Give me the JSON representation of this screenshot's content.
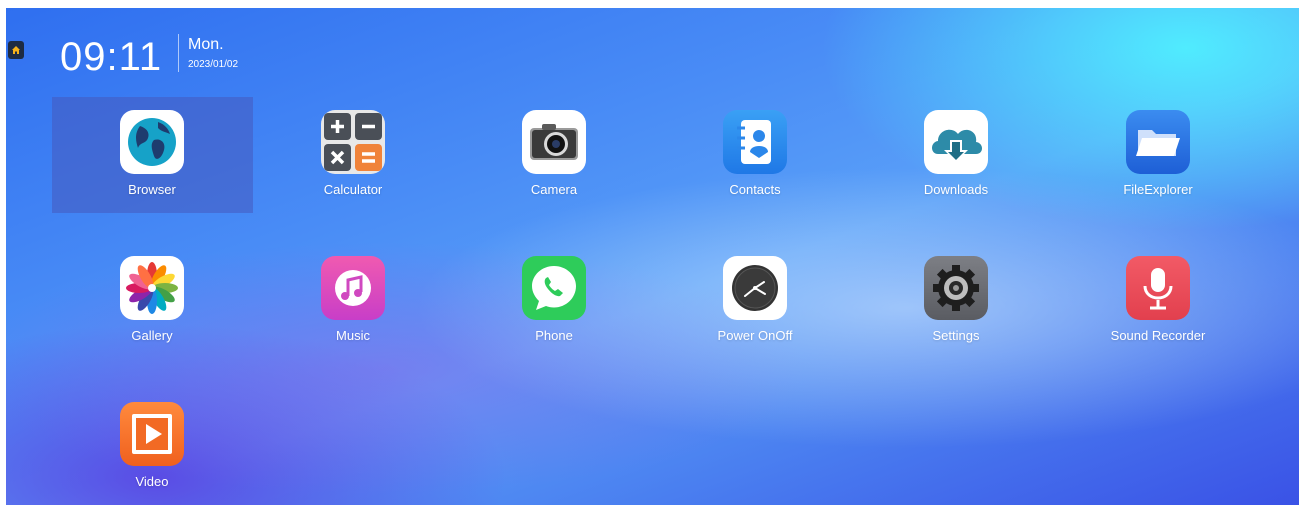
{
  "status": {
    "time": "09:11",
    "day": "Mon.",
    "date": "2023/01/02"
  },
  "apps": [
    {
      "label": "Browser",
      "icon": "globe-icon",
      "selected": true
    },
    {
      "label": "Calculator",
      "icon": "calculator-icon"
    },
    {
      "label": "Camera",
      "icon": "camera-icon"
    },
    {
      "label": "Contacts",
      "icon": "contacts-icon"
    },
    {
      "label": "Downloads",
      "icon": "cloud-download-icon"
    },
    {
      "label": "FileExplorer",
      "icon": "folder-icon"
    },
    {
      "label": "Gallery",
      "icon": "flower-icon"
    },
    {
      "label": "Music",
      "icon": "music-note-icon"
    },
    {
      "label": "Phone",
      "icon": "phone-icon"
    },
    {
      "label": "Power OnOff",
      "icon": "clock-icon"
    },
    {
      "label": "Settings",
      "icon": "gear-icon"
    },
    {
      "label": "Sound Recorder",
      "icon": "microphone-icon"
    },
    {
      "label": "Video",
      "icon": "play-icon"
    }
  ],
  "colors": {
    "selection": "#4a5bbe",
    "home_button": "#1d2b44"
  }
}
